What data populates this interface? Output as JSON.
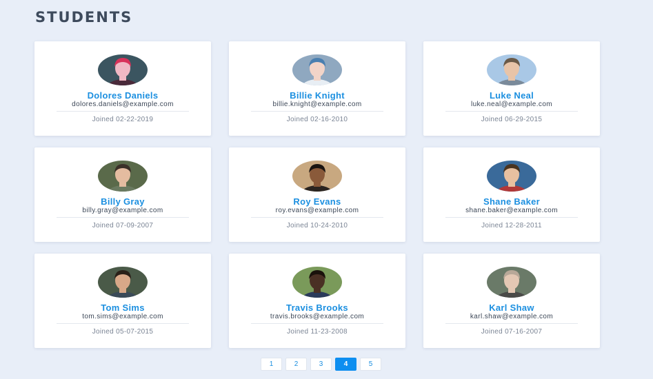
{
  "page": {
    "title": "STUDENTS"
  },
  "students": [
    {
      "name": "Dolores Daniels",
      "email": "dolores.daniels@example.com",
      "joined": "Joined 02-22-2019",
      "avatar": {
        "icon": "person-photo-icon",
        "bg": "#3b5560",
        "skin": "#f0b8c4",
        "hair": "#d8325a",
        "shirt": "#4a2a3a"
      }
    },
    {
      "name": "Billie Knight",
      "email": "billie.knight@example.com",
      "joined": "Joined 02-16-2010",
      "avatar": {
        "icon": "person-photo-icon",
        "bg": "#8fa8c0",
        "skin": "#f2d4c8",
        "hair": "#4a7fb0",
        "shirt": "#e8eef4"
      }
    },
    {
      "name": "Luke Neal",
      "email": "luke.neal@example.com",
      "joined": "Joined 06-29-2015",
      "avatar": {
        "icon": "person-photo-icon",
        "bg": "#a9c8e6",
        "skin": "#e8c4a8",
        "hair": "#6a5a48",
        "shirt": "#7a8a9a"
      }
    },
    {
      "name": "Billy Gray",
      "email": "billy.gray@example.com",
      "joined": "Joined 07-09-2007",
      "avatar": {
        "icon": "person-photo-icon",
        "bg": "#5a6a4a",
        "skin": "#e4bca0",
        "hair": "#3a3028",
        "shirt": "#6a7a60"
      }
    },
    {
      "name": "Roy Evans",
      "email": "roy.evans@example.com",
      "joined": "Joined 10-24-2010",
      "avatar": {
        "icon": "person-photo-icon",
        "bg": "#c8a880",
        "skin": "#8a5a3a",
        "hair": "#1a1410",
        "shirt": "#2a2420"
      }
    },
    {
      "name": "Shane Baker",
      "email": "shane.baker@example.com",
      "joined": "Joined 12-28-2011",
      "avatar": {
        "icon": "person-photo-icon",
        "bg": "#3a6a9a",
        "skin": "#e8c0a0",
        "hair": "#4a3420",
        "shirt": "#b03838"
      }
    },
    {
      "name": "Tom Sims",
      "email": "tom.sims@example.com",
      "joined": "Joined 05-07-2015",
      "avatar": {
        "icon": "person-photo-icon",
        "bg": "#4a5a48",
        "skin": "#d8a888",
        "hair": "#2a2018",
        "shirt": "#3a4a58"
      }
    },
    {
      "name": "Travis Brooks",
      "email": "travis.brooks@example.com",
      "joined": "Joined 11-23-2008",
      "avatar": {
        "icon": "person-photo-icon",
        "bg": "#7a9a5a",
        "skin": "#4a3024",
        "hair": "#1a120c",
        "shirt": "#2a3a5a"
      }
    },
    {
      "name": "Karl Shaw",
      "email": "karl.shaw@example.com",
      "joined": "Joined 07-16-2007",
      "avatar": {
        "icon": "person-photo-icon",
        "bg": "#6a7a68",
        "skin": "#e4c8b4",
        "hair": "#b8a898",
        "shirt": "#4a4a48"
      }
    }
  ],
  "pagination": {
    "pages": [
      "1",
      "2",
      "3",
      "4",
      "5"
    ],
    "current": "4"
  },
  "colors": {
    "background": "#e8eef8",
    "accent": "#0d8ef0",
    "name": "#1b8fe0",
    "title": "#3d4a5c"
  }
}
